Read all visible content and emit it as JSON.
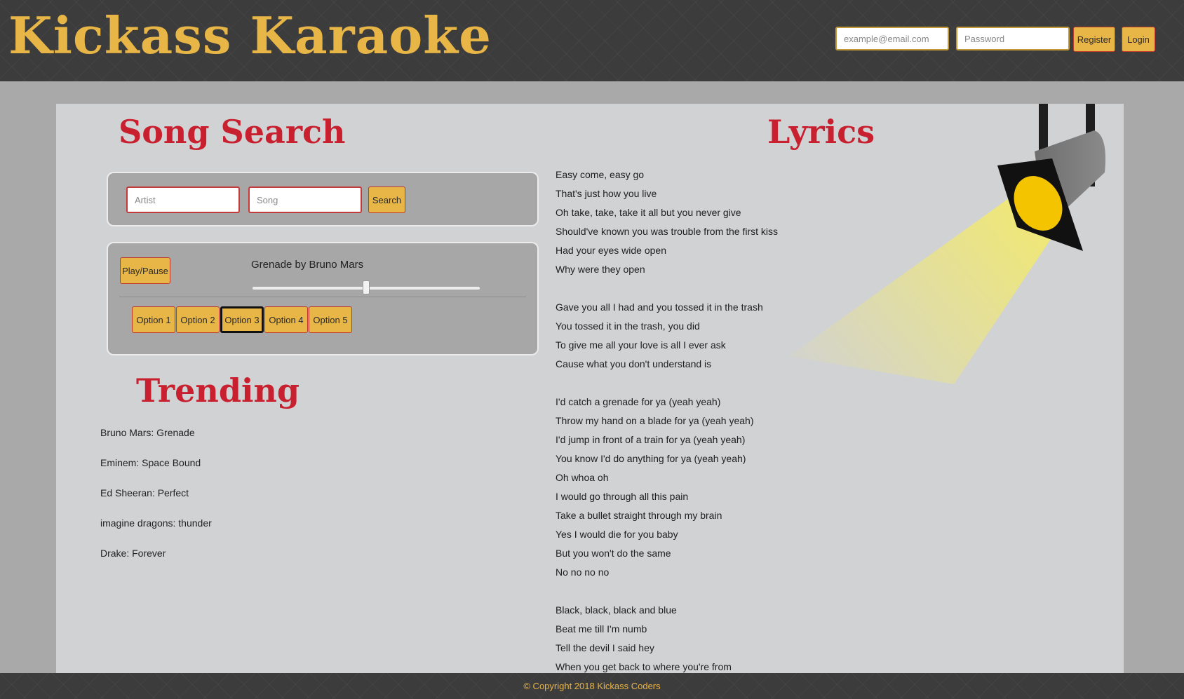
{
  "header": {
    "brand": "Kickass Karaoke",
    "email_placeholder": "example@email.com",
    "password_placeholder": "Password",
    "register_label": "Register",
    "login_label": "Login"
  },
  "song_search": {
    "title": "Song Search",
    "artist_placeholder": "Artist",
    "song_placeholder": "Song",
    "search_label": "Search"
  },
  "player": {
    "play_pause_label": "Play/Pause",
    "now_playing": "Grenade by Bruno Mars",
    "slider_fraction": 0.5,
    "options": [
      "Option 1",
      "Option 2",
      "Option 3",
      "Option 4",
      "Option 5"
    ],
    "selected_option": 2
  },
  "trending": {
    "title": "Trending",
    "items": [
      "Bruno Mars: Grenade",
      "Eminem: Space Bound",
      "Ed Sheeran: Perfect",
      "imagine dragons: thunder",
      "Drake: Forever"
    ]
  },
  "lyrics": {
    "title": "Lyrics",
    "lines": [
      "Easy come, easy go",
      "That's just how you live",
      "Oh take, take, take it all but you never give",
      "Should've known you was trouble from the first kiss",
      "Had your eyes wide open",
      "Why were they open",
      "",
      "Gave you all I had and you tossed it in the trash",
      "You tossed it in the trash, you did",
      "To give me all your love is all I ever ask",
      "Cause what you don't understand is",
      "",
      "I'd catch a grenade for ya (yeah yeah)",
      "Throw my hand on a blade for ya (yeah yeah)",
      "I'd jump in front of a train for ya (yeah yeah)",
      "You know I'd do anything for ya (yeah yeah)",
      "Oh whoa oh",
      "I would go through all this pain",
      "Take a bullet straight through my brain",
      "Yes I would die for you baby",
      "But you won't do the same",
      "No no no no",
      "",
      "Black, black, black and blue",
      "Beat me till I'm numb",
      "Tell the devil I said hey",
      "When you get back to where you're from"
    ]
  },
  "footer": {
    "copyright": "© Copyright 2018 Kickass Coders"
  },
  "colors": {
    "accent_gold": "#e8b547",
    "title_red": "#c8202f",
    "header_bg": "#3c3c3c",
    "panel_bg": "#d1d2d4"
  }
}
